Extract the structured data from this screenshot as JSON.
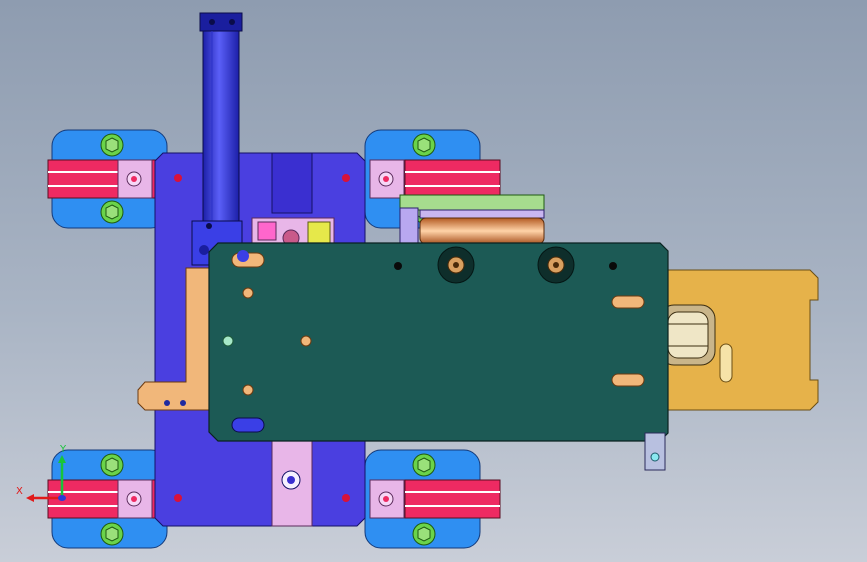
{
  "viewport": {
    "background_top": "#8e9cb0",
    "background_bottom": "#c9ced8"
  },
  "triad": {
    "x_label": "X",
    "y_label": "Y",
    "x_color": "#e01a1a",
    "y_color": "#19c43a",
    "z_color": "#2a3ad8"
  },
  "colors": {
    "base_plate": "#4a3fe0",
    "cover_plate": "#1c5a55",
    "wheel_blue": "#2f8ff2",
    "rail_red": "#ee2a62",
    "bolt_green": "#6ad34a",
    "block_pink": "#e8b6e8",
    "bracket_orange": "#f1b77a",
    "rod_blue": "#3b3fe6",
    "motor_green": "#a6dc8e",
    "motor_copper": "#d98c52",
    "rear_plate": "#e6b24a"
  }
}
